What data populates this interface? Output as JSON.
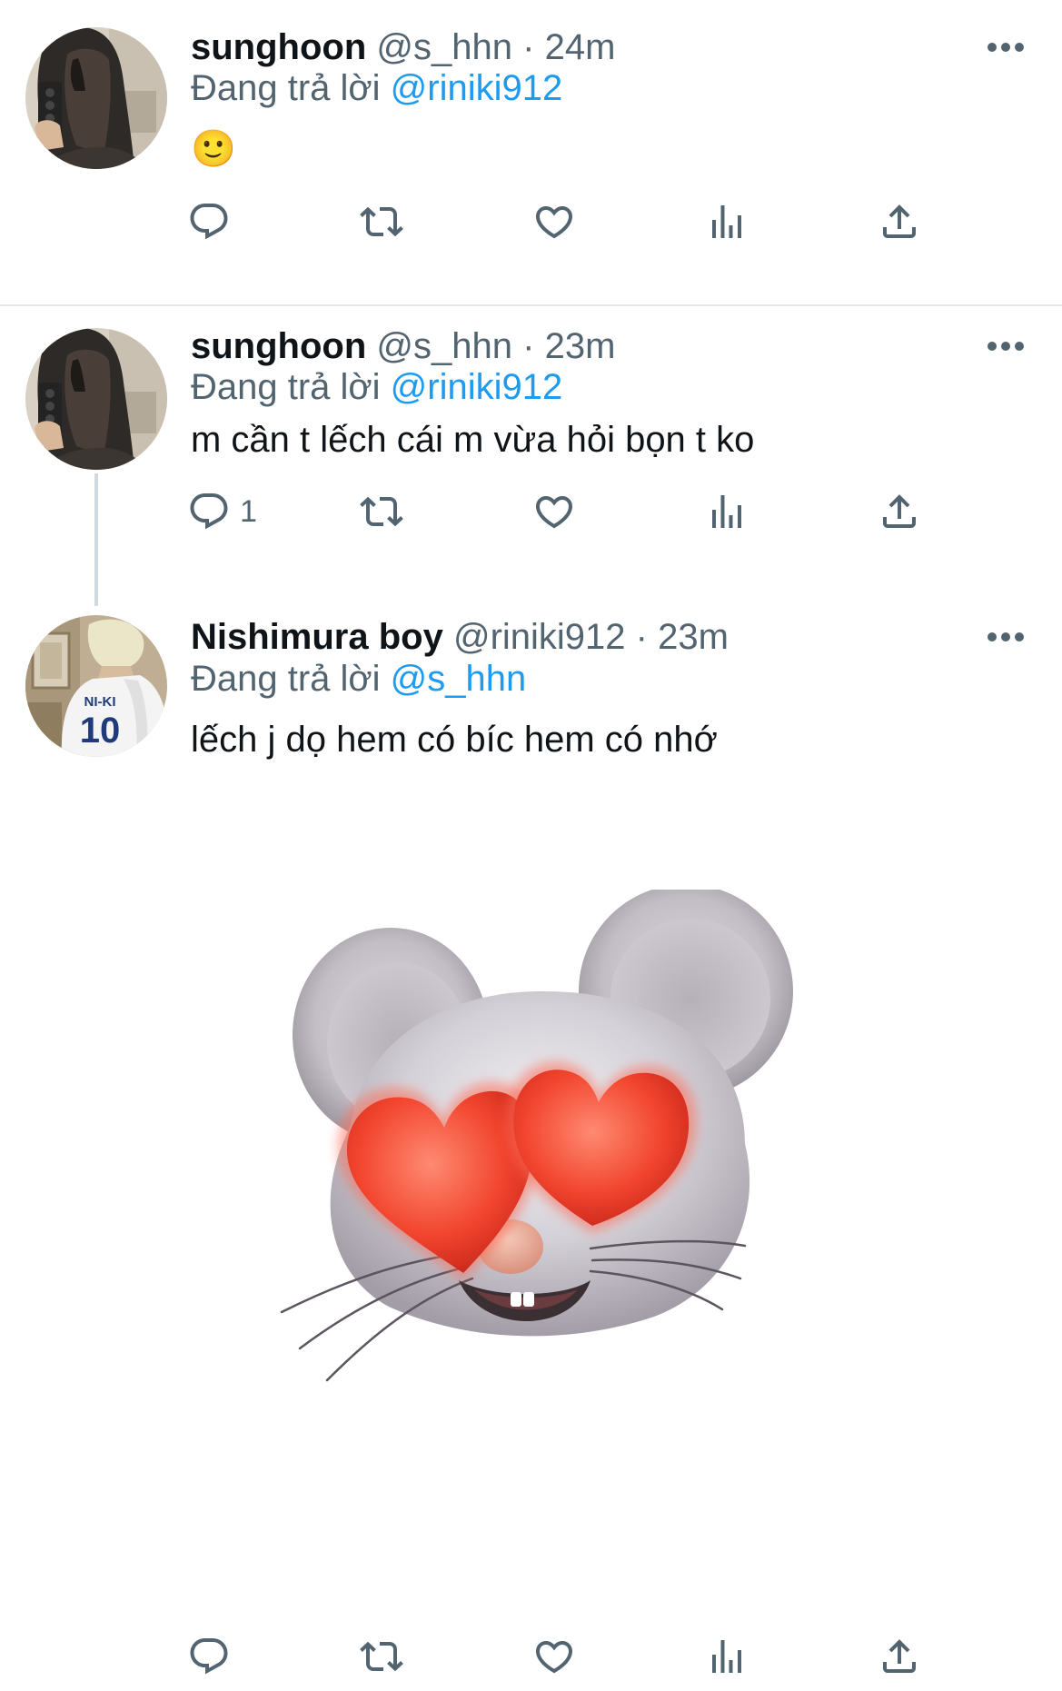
{
  "tweets": [
    {
      "display_name": "sunghoon",
      "handle": "@s_hhn",
      "separator": "·",
      "time": "24m",
      "reply_prefix": "Đang trả lời",
      "reply_to": "@riniki912",
      "text": "🙂",
      "reply_count": ""
    },
    {
      "display_name": "sunghoon",
      "handle": "@s_hhn",
      "separator": "·",
      "time": "23m",
      "reply_prefix": "Đang trả lời",
      "reply_to": "@riniki912",
      "text": "m cần t lếch cái m vừa hỏi bọn t ko",
      "reply_count": "1"
    },
    {
      "display_name": "Nishimura boy",
      "handle": "@riniki912",
      "separator": "·",
      "time": "23m",
      "reply_prefix": "Đang trả lời",
      "reply_to": "@s_hhn",
      "text": "lếch j dọ hem có bíc hem có nhớ",
      "reply_count": "",
      "jersey_text": "NI-KI",
      "jersey_number": "10"
    }
  ],
  "icons": {
    "reply": "reply-icon",
    "retweet": "retweet-icon",
    "like": "like-icon",
    "views": "views-icon",
    "share": "share-icon",
    "more": "more-icon"
  },
  "colors": {
    "text": "#0f1419",
    "secondary": "#536471",
    "link": "#1d9bf0",
    "divider": "#e6e9eb",
    "thread_line": "#cfd9de"
  }
}
